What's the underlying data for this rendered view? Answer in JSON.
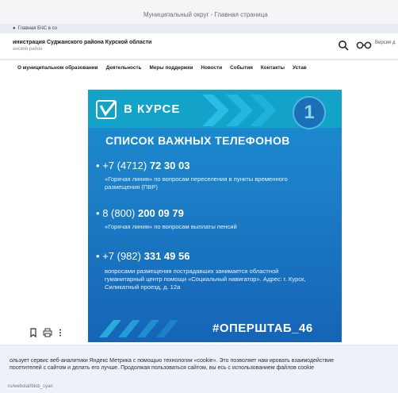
{
  "browser": {
    "tab_title": "Муниципальный округ - Главная страница"
  },
  "page_label": {
    "text": "Главная БЧС в со"
  },
  "header": {
    "title": "инистрация Суджанского района Курской области",
    "subtitle": "анский район",
    "version_label": "Версия д"
  },
  "nav": {
    "items": [
      "О муниципальном образовании",
      "Деятельность",
      "Меры поддержки",
      "Новости",
      "События",
      "Контакты",
      "Устав"
    ]
  },
  "poster": {
    "brand": "В КУРСЕ",
    "number": "1",
    "title": "СПИСОК ВАЖНЫХ ТЕЛЕФОНОВ",
    "entries": [
      {
        "prefix": "+7 (4712)",
        "number": "72 30 03",
        "note": "«Горячая линия» по вопросам переселения в пункты временного размещения (ПВР)"
      },
      {
        "prefix": "8 (800)",
        "number": "200 09 79",
        "note": "«Горячая линия» по вопросам выплаты пенсий"
      },
      {
        "prefix": "+7 (982)",
        "number": "331 49 56",
        "note": "вопросами размещения пострадавших занимается областной гуманитарный центр помощи «Социальный навигатор». Адрес: г. Курск, Силикатный проезд, д. 12а"
      }
    ],
    "hashtag": "#ОПЕРШТАБ_46"
  },
  "cookie": {
    "text": "ользует сервис веб-аналитики Яндекс Метрика с помощью технологии «cookie». Это позволяет нам ировать взаимодействие посетителей с сайтом и делать его лучше. Продолжая пользоваться сайтом, вы есь с использованием файлов cookie"
  },
  "status": {
    "url": "ru/webstat/blob_cyan"
  },
  "icons": [
    "search-icon",
    "glasses-icon",
    "bookmark-icon",
    "print-icon",
    "more-icon"
  ]
}
